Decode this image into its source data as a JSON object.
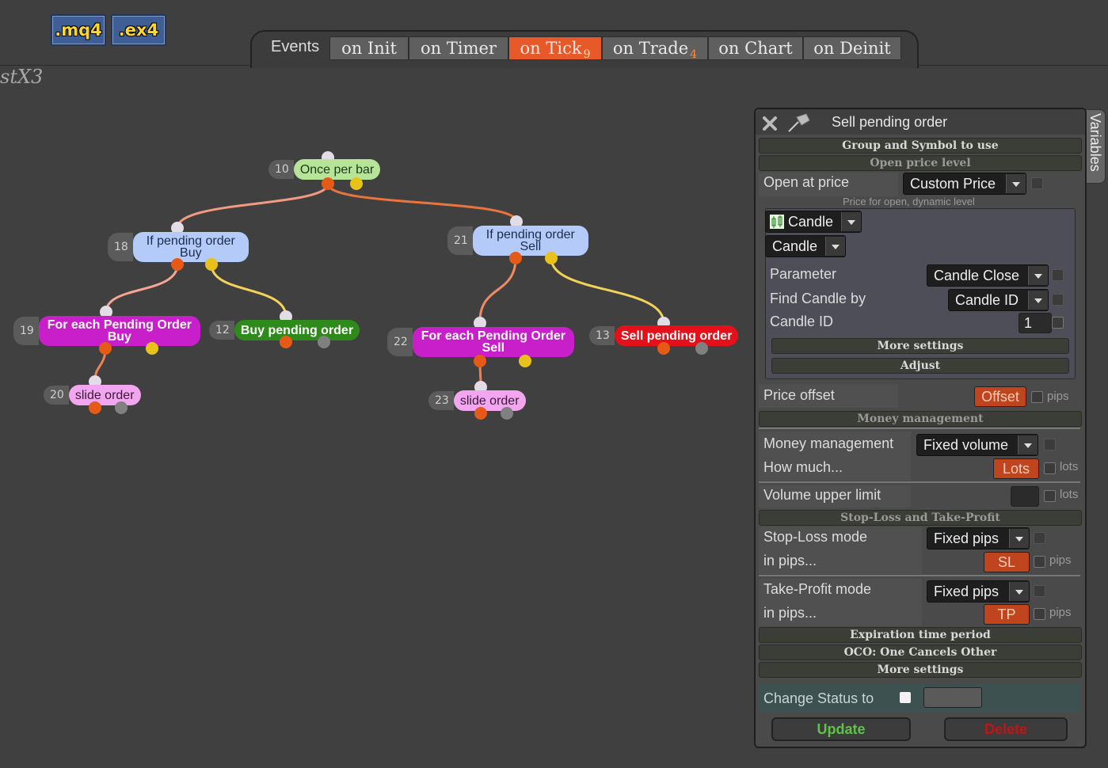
{
  "toolbar": {
    "mq4_label": ".mq4",
    "ex4_label": ".ex4"
  },
  "project_name": "stX3",
  "tabs": {
    "label": "Events",
    "items": [
      {
        "label": "on Init",
        "count": ""
      },
      {
        "label": "on Timer",
        "count": ""
      },
      {
        "label": "on Tick",
        "count": "9"
      },
      {
        "label": "on Trade",
        "count": "4"
      },
      {
        "label": "on Chart",
        "count": ""
      },
      {
        "label": "on Deinit",
        "count": ""
      }
    ]
  },
  "nodes": [
    {
      "id": "10",
      "label": "Once per bar",
      "color": "#b6e59a"
    },
    {
      "id": "18",
      "label": "If pending order Buy",
      "color": "#b4cbfa"
    },
    {
      "id": "21",
      "label": "If pending order Sell",
      "color": "#b4cbfa"
    },
    {
      "id": "19",
      "label": "For each Pending Order Buy",
      "color": "#c81fcb"
    },
    {
      "id": "12",
      "label": "Buy pending order",
      "color": "#2f8a1c"
    },
    {
      "id": "22",
      "label": "For each Pending Order Sell",
      "color": "#c81fcb"
    },
    {
      "id": "13",
      "label": "Sell pending order",
      "color": "#e4111a"
    },
    {
      "id": "20",
      "label": "slide order",
      "color": "#f3a6f0"
    },
    {
      "id": "23",
      "label": "slide order",
      "color": "#f3a6f0"
    }
  ],
  "panel": {
    "title": "Sell pending order",
    "variables_tab": "Variables",
    "sections": {
      "group_symbol": "Group and Symbol to use",
      "open_price": "Open price level",
      "more_settings_inner": "More settings",
      "adjust": "Adjust",
      "money": "Money management",
      "sltp": "Stop-Loss and Take-Profit",
      "expiration": "Expiration time period",
      "oco": "OCO: One Cancels Other",
      "more_settings": "More settings"
    },
    "open_at_price": {
      "label": "Open at price",
      "value": "Custom Price"
    },
    "hint": "Price for open, dynamic level",
    "candle_dd1": "Candle",
    "candle_dd2": "Candle",
    "parameter": {
      "label": "Parameter",
      "value": "Candle Close"
    },
    "find_candle": {
      "label": "Find Candle by",
      "value": "Candle ID"
    },
    "candle_id": {
      "label": "Candle ID",
      "value": "1"
    },
    "price_offset": {
      "label": "Price offset",
      "value": "Offset",
      "unit": "pips"
    },
    "mm": {
      "label": "Money management",
      "value": "Fixed volume"
    },
    "how_much": {
      "label": "How much...",
      "value": "Lots",
      "unit": "lots"
    },
    "vol_limit": {
      "label": "Volume upper limit",
      "unit": "lots"
    },
    "sl_mode": {
      "label": "Stop-Loss mode",
      "value": "Fixed pips"
    },
    "sl_pips": {
      "label": "in pips...",
      "value": "SL",
      "unit": "pips"
    },
    "tp_mode": {
      "label": "Take-Profit mode",
      "value": "Fixed pips"
    },
    "tp_pips": {
      "label": "in pips...",
      "value": "TP",
      "unit": "pips"
    },
    "change_status": "Change Status to",
    "update": "Update",
    "delete": "Delete"
  }
}
